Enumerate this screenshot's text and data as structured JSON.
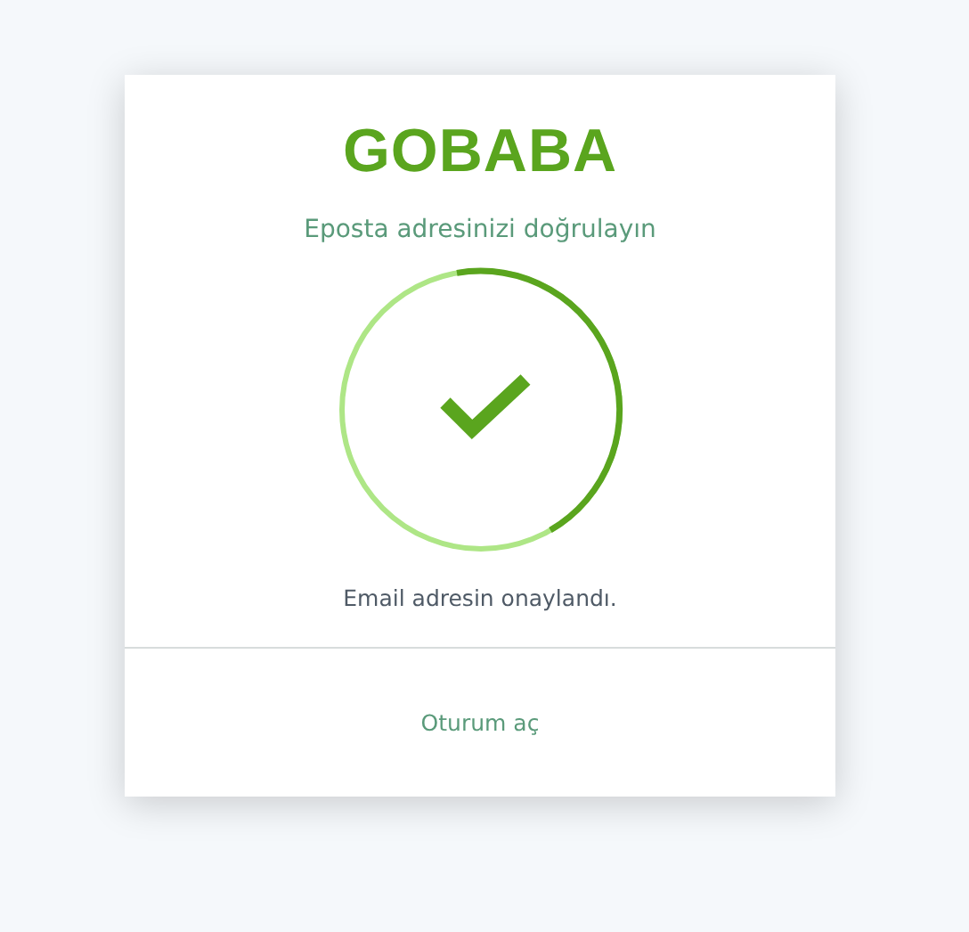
{
  "card": {
    "logo": "GOBABA",
    "title": "Eposta adresinizi doğrulayın",
    "message": "Email adresin onaylandı.",
    "link": "Oturum aç"
  }
}
